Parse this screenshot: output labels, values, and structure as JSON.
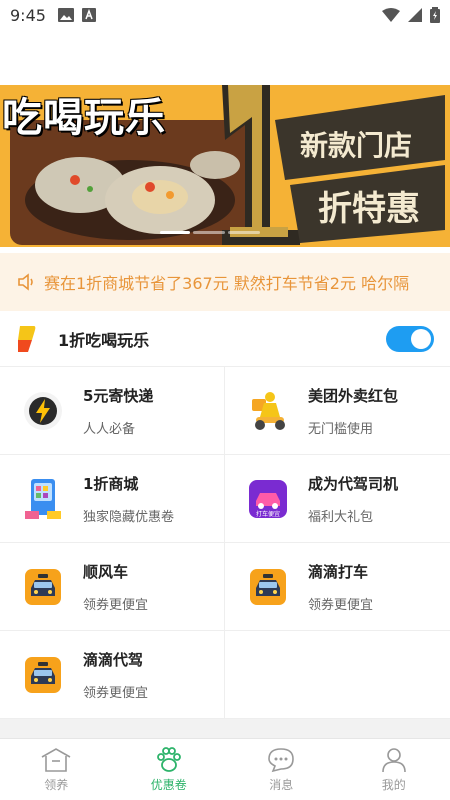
{
  "status": {
    "time": "9:45"
  },
  "banner": {
    "title": "吃喝玩乐",
    "big_number": "1",
    "side_text_1": "新款门店",
    "side_text_2": "折特惠"
  },
  "notice": {
    "text": "赛在1折商城节省了367元 默然打车节省2元 哈尔隔"
  },
  "section": {
    "title": "1折吃喝玩乐",
    "toggle_on": true
  },
  "items": [
    {
      "name": "5元寄快递",
      "desc": "人人必备",
      "icon": "lightning-icon"
    },
    {
      "name": "美团外卖红包",
      "desc": "无门槛使用",
      "icon": "delivery-rider-icon"
    },
    {
      "name": "1折商城",
      "desc": "独家隐藏优惠卷",
      "icon": "vending-machine-icon"
    },
    {
      "name": "成为代驾司机",
      "desc": "福利大礼包",
      "icon": "driver-car-icon"
    },
    {
      "name": "顺风车",
      "desc": "领券更便宜",
      "icon": "taxi-icon"
    },
    {
      "name": "滴滴打车",
      "desc": "领券更便宜",
      "icon": "taxi-icon"
    },
    {
      "name": "滴滴代驾",
      "desc": "领券更便宜",
      "icon": "taxi-icon"
    }
  ],
  "driver_badge": "打车便宜",
  "tabs": [
    {
      "label": "领养",
      "icon": "house-icon"
    },
    {
      "label": "优惠卷",
      "icon": "paw-icon",
      "active": true
    },
    {
      "label": "消息",
      "icon": "chat-icon"
    },
    {
      "label": "我的",
      "icon": "user-icon"
    }
  ],
  "colors": {
    "accent": "#2db36a",
    "toggle": "#1e9df2",
    "notice_text": "#e8953a",
    "banner_bg": "#f5b236"
  }
}
